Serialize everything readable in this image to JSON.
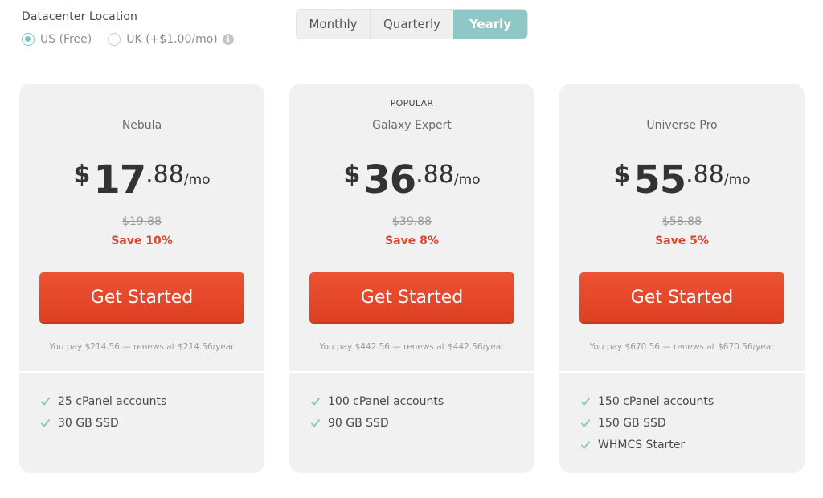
{
  "location": {
    "title": "Datacenter Location",
    "options": [
      {
        "label": "US (Free)",
        "selected": true
      },
      {
        "label": "UK (+$1.00/mo)",
        "selected": false
      }
    ]
  },
  "billing": {
    "options": [
      "Monthly",
      "Quarterly",
      "Yearly"
    ],
    "selected": "Yearly"
  },
  "colors": {
    "accent_teal": "#8ec7c5",
    "cta_red": "#e74a2d",
    "save_red": "#e0432a",
    "card_bg": "#f1f1f1"
  },
  "plans": [
    {
      "badge": "",
      "name": "Nebula",
      "currency": "$",
      "dollars": "17",
      "cents": ".88",
      "per": "/mo",
      "old_price": "$19.88",
      "save": "Save 10%",
      "cta": "Get Started",
      "renew": "You pay $214.56 — renews at $214.56/year",
      "features": [
        "25 cPanel accounts",
        "30 GB SSD"
      ]
    },
    {
      "badge": "POPULAR",
      "name": "Galaxy Expert",
      "currency": "$",
      "dollars": "36",
      "cents": ".88",
      "per": "/mo",
      "old_price": "$39.88",
      "save": "Save 8%",
      "cta": "Get Started",
      "renew": "You pay $442.56 — renews at $442.56/year",
      "features": [
        "100 cPanel accounts",
        "90 GB SSD"
      ]
    },
    {
      "badge": "",
      "name": "Universe Pro",
      "currency": "$",
      "dollars": "55",
      "cents": ".88",
      "per": "/mo",
      "old_price": "$58.88",
      "save": "Save 5%",
      "cta": "Get Started",
      "renew": "You pay $670.56 — renews at $670.56/year",
      "features": [
        "150 cPanel accounts",
        "150 GB SSD",
        "WHMCS Starter"
      ]
    }
  ]
}
